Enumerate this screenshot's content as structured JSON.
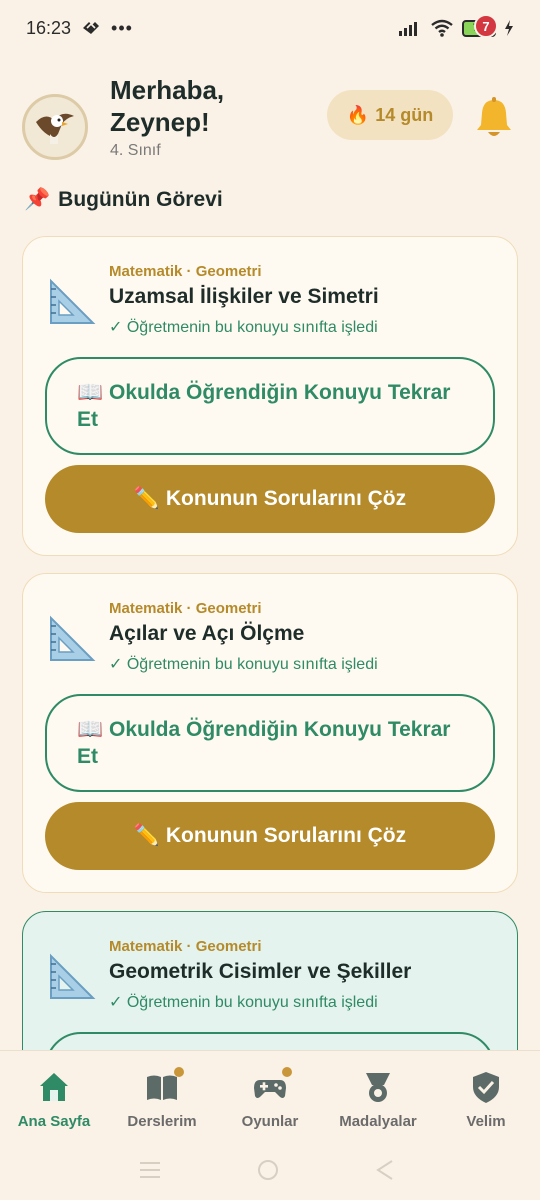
{
  "status_bar": {
    "time": "16:23",
    "battery": "79"
  },
  "header": {
    "greeting": "Merhaba,\nZeynep!",
    "grade": "4. Sınıf",
    "streak": "14 gün",
    "notification_count": "7"
  },
  "section": {
    "icon": "📌",
    "title": "Bugünün Görevi"
  },
  "cards": [
    {
      "subject": "Matematik · Geometri",
      "title": "Uzamsal İlişkiler ve Simetri",
      "note": "✓ Öğretmenin bu konuyu sınıfta işledi",
      "review_label": "📖 Okulda Öğrendiğin Konuyu Tekrar Et",
      "solve_label": "✏️ Konunun Sorularını Çöz",
      "icon": "ruler-triangle-icon"
    },
    {
      "subject": "Matematik · Geometri",
      "title": "Açılar ve Açı Ölçme",
      "note": "✓ Öğretmenin bu konuyu sınıfta işledi",
      "review_label": "📖 Okulda Öğrendiğin Konuyu Tekrar Et",
      "solve_label": "✏️ Konunun Sorularını Çöz",
      "icon": "ruler-triangle-icon"
    },
    {
      "subject": "Matematik · Geometri",
      "title": "Geometrik Cisimler ve Şekiller",
      "note": "✓ Öğretmenin bu konuyu sınıfta işledi",
      "icon": "ruler-triangle-icon"
    }
  ],
  "nav": [
    {
      "label": "Ana Sayfa",
      "icon": "home-icon",
      "active": true
    },
    {
      "label": "Derslerim",
      "icon": "book-icon"
    },
    {
      "label": "Oyunlar",
      "icon": "gamepad-icon"
    },
    {
      "label": "Madalyalar",
      "icon": "medal-icon"
    },
    {
      "label": "Velim",
      "icon": "shield-check-icon"
    }
  ],
  "colors": {
    "background": "#fbf2e7",
    "accent_green": "#2f8a66",
    "accent_gold": "#b58a2a",
    "badge_red": "#d3373f"
  }
}
